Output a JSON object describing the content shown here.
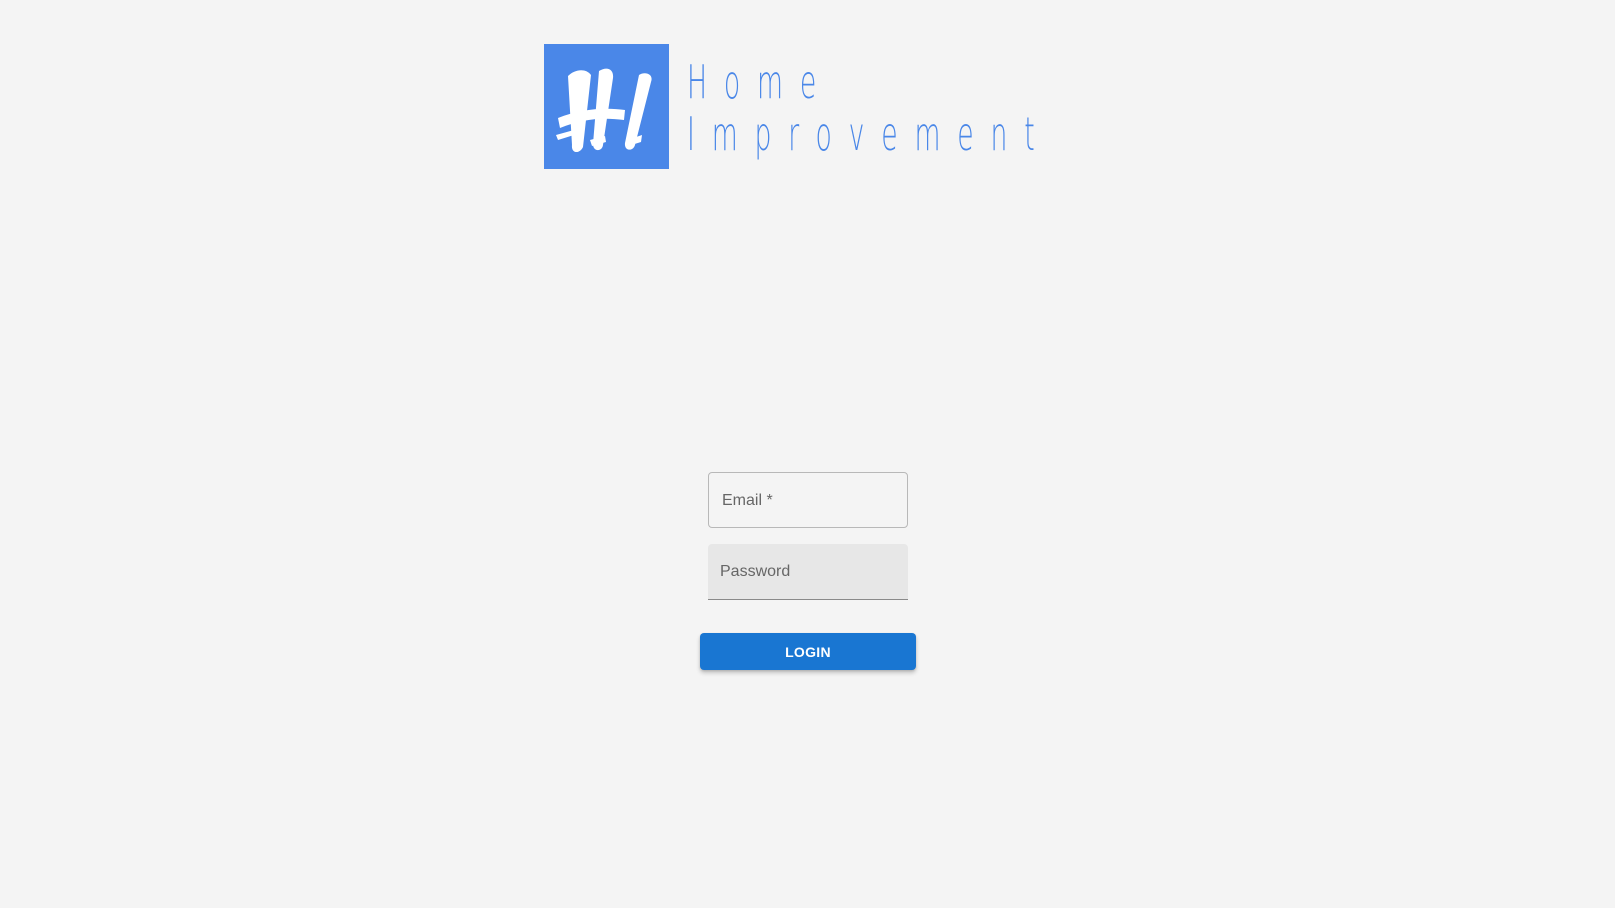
{
  "brand": {
    "initials": "HI",
    "name_line_1": "Home",
    "name_line_2": "Improvement",
    "accent": "#4a87e8"
  },
  "login_form": {
    "email_label": "Email *",
    "email_value": "",
    "password_label": "Password",
    "password_value": "",
    "button_label": "LOGIN",
    "button_color": "#1976d2"
  },
  "background": "#f4f4f4"
}
